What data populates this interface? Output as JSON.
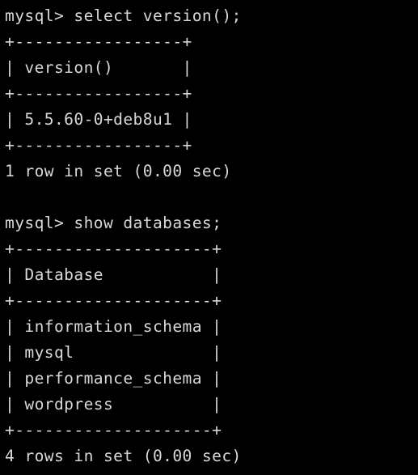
{
  "terminal": {
    "lines": [
      "mysql> select version();",
      "+-----------------+",
      "| version()       |",
      "+-----------------+",
      "| 5.5.60-0+deb8u1 |",
      "+-----------------+",
      "1 row in set (0.00 sec)",
      "",
      "mysql> show databases;",
      "+--------------------+",
      "| Database           |",
      "+--------------------+",
      "| information_schema |",
      "| mysql              |",
      "| performance_schema |",
      "| wordpress          |",
      "+--------------------+",
      "4 rows in set (0.00 sec)"
    ]
  },
  "colors": {
    "background": "#000000",
    "text": "#d8d8d8"
  }
}
